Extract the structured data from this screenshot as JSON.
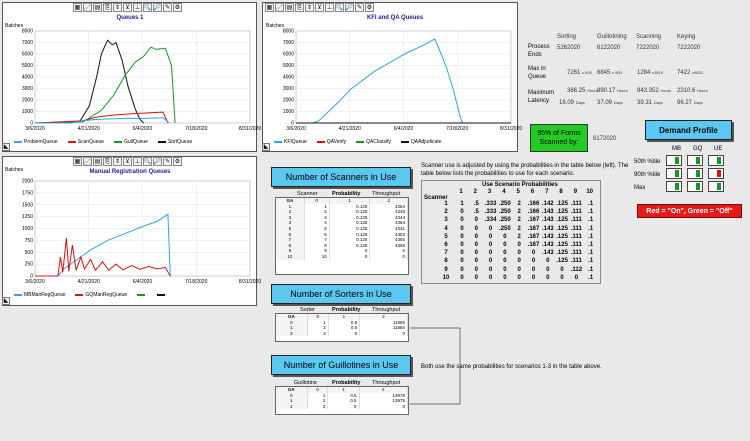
{
  "toolbar_icons": [
    "table-icon",
    "line-chart-icon",
    "bar-chart-icon",
    "export-icon",
    "scale-icon",
    "filter-icon",
    "axis-icon",
    "zoom-in-icon",
    "zoom-out-icon",
    "pen-icon",
    "settings-icon"
  ],
  "toolbar_glyphs": [
    "▦",
    "📈",
    "▤",
    "⎘",
    "⇕",
    "⊻",
    "⊥",
    "🔍",
    "🔎",
    "✎",
    "⚙"
  ],
  "charts": {
    "queues1": {
      "title": "Queues 1",
      "ylabel": "Batches",
      "yticks": [
        "8000",
        "7000",
        "6000",
        "5000",
        "4000",
        "3000",
        "2000",
        "1000",
        "0"
      ],
      "xticks": [
        "3/6/2020",
        "4/21/2020",
        "6/4/2020",
        "7/18/2020",
        "8/31/2020"
      ],
      "legend": [
        {
          "name": "ProblemQueue",
          "color": "#2aa7e6"
        },
        {
          "name": "ScanQueue",
          "color": "#dd1111"
        },
        {
          "name": "GuilQueue",
          "color": "#119922"
        },
        {
          "name": "SortQueue",
          "color": "#111111"
        }
      ]
    },
    "kfi": {
      "title": "KFI and QA Queues",
      "ylabel": "Batches",
      "yticks": [
        "8000",
        "7000",
        "6000",
        "5000",
        "4000",
        "3000",
        "2000",
        "1000",
        "0"
      ],
      "xticks": [
        "3/6/2020",
        "4/21/2020",
        "6/4/2020",
        "7/18/2020",
        "8/31/2020"
      ],
      "legend": [
        {
          "name": "KFIQueue",
          "color": "#2aa7e6"
        },
        {
          "name": "QAVerify",
          "color": "#dd1111"
        },
        {
          "name": "QAClassify",
          "color": "#119922"
        },
        {
          "name": "QAAdjudicate",
          "color": "#111111"
        }
      ]
    },
    "manual": {
      "title": "Manual Registration Queues",
      "ylabel": "Batches",
      "yticks": [
        "2000",
        "1750",
        "1500",
        "1250",
        "1000",
        "750",
        "500",
        "250",
        "0"
      ],
      "xticks": [
        "3/6/2020",
        "4/21/2020",
        "6/4/2020",
        "7/18/2020",
        "8/31/2020"
      ],
      "legend": [
        {
          "name": "MBManRegQueue",
          "color": "#2aa7e6"
        },
        {
          "name": "GQManRegQueue",
          "color": "#dd1111"
        },
        {
          "name": "",
          "color": "#119922"
        },
        {
          "name": "",
          "color": "#111111"
        }
      ]
    }
  },
  "chart_data": [
    {
      "type": "line",
      "title": "Queues 1",
      "ylabel": "Batches",
      "ylim": [
        0,
        8000
      ],
      "xlim": [
        "3/6/2020",
        "8/31/2020"
      ],
      "series": [
        {
          "name": "SortQueue",
          "points": [
            [
              "3/6/2020",
              0
            ],
            [
              "4/12/2020",
              100
            ],
            [
              "4/20/2020",
              1500
            ],
            [
              "4/26/2020",
              4000
            ],
            [
              "4/30/2020",
              6000
            ],
            [
              "5/5/2020",
              7200
            ],
            [
              "5/9/2020",
              6800
            ],
            [
              "5/12/2020",
              7000
            ],
            [
              "5/17/2020",
              5500
            ],
            [
              "5/22/2020",
              3200
            ],
            [
              "5/28/2020",
              1200
            ],
            [
              "6/1/2020",
              300
            ],
            [
              "6/4/2020",
              0
            ]
          ]
        },
        {
          "name": "GuilQueue",
          "points": [
            [
              "3/6/2020",
              0
            ],
            [
              "4/15/2020",
              100
            ],
            [
              "4/30/2020",
              1100
            ],
            [
              "5/10/2020",
              2400
            ],
            [
              "5/20/2020",
              4200
            ],
            [
              "5/28/2020",
              5300
            ],
            [
              "6/4/2020",
              5800
            ],
            [
              "6/10/2020",
              6600
            ],
            [
              "6/14/2020",
              6400
            ],
            [
              "6/22/2020",
              6500
            ],
            [
              "6/27/2020",
              5000
            ],
            [
              "6/30/2020",
              0
            ]
          ]
        },
        {
          "name": "ScanQueue",
          "points": [
            [
              "3/6/2020",
              0
            ],
            [
              "4/15/2020",
              200
            ],
            [
              "4/25/2020",
              500
            ],
            [
              "5/10/2020",
              700
            ],
            [
              "5/25/2020",
              800
            ],
            [
              "6/10/2020",
              900
            ],
            [
              "6/20/2020",
              950
            ],
            [
              "6/24/2020",
              0
            ]
          ]
        },
        {
          "name": "ProblemQueue",
          "points": [
            [
              "3/6/2020",
              0
            ],
            [
              "4/5/2020",
              0
            ],
            [
              "4/15/2020",
              200
            ],
            [
              "4/25/2020",
              300
            ],
            [
              "5/5/2020",
              350
            ],
            [
              "5/20/2020",
              400
            ],
            [
              "6/4/2020",
              400
            ],
            [
              "6/20/2020",
              450
            ],
            [
              "6/25/2020",
              0
            ]
          ]
        }
      ]
    },
    {
      "type": "line",
      "title": "KFI and QA Queues",
      "ylabel": "Batches",
      "ylim": [
        0,
        8000
      ],
      "xlim": [
        "3/6/2020",
        "8/31/2020"
      ],
      "series": [
        {
          "name": "KFIQueue",
          "points": [
            [
              "3/6/2020",
              0
            ],
            [
              "3/20/2020",
              0
            ],
            [
              "3/25/2020",
              200
            ],
            [
              "4/10/2020",
              1800
            ],
            [
              "4/21/2020",
              3000
            ],
            [
              "5/10/2020",
              4500
            ],
            [
              "6/4/2020",
              6000
            ],
            [
              "6/20/2020",
              6800
            ],
            [
              "6/29/2020",
              7300
            ],
            [
              "7/8/2020",
              5000
            ],
            [
              "7/14/2020",
              3000
            ],
            [
              "7/20/2020",
              500
            ],
            [
              "7/22/2020",
              0
            ]
          ]
        },
        {
          "name": "QAVerify",
          "points": [
            [
              "3/6/2020",
              0
            ],
            [
              "8/31/2020",
              0
            ]
          ]
        },
        {
          "name": "QAClassify",
          "points": [
            [
              "3/6/2020",
              0
            ],
            [
              "8/31/2020",
              0
            ]
          ]
        },
        {
          "name": "QAAdjudicate",
          "points": [
            [
              "3/6/2020",
              0
            ],
            [
              "8/31/2020",
              0
            ]
          ]
        }
      ]
    },
    {
      "type": "line",
      "title": "Manual Registration Queues",
      "ylabel": "Batches",
      "ylim": [
        0,
        2000
      ],
      "xlim": [
        "3/6/2020",
        "8/31/2020"
      ],
      "series": [
        {
          "name": "MBManRegQueue",
          "points": [
            [
              "3/6/2020",
              0
            ],
            [
              "3/25/2020",
              0
            ],
            [
              "3/30/2020",
              150
            ],
            [
              "4/10/2020",
              350
            ],
            [
              "4/21/2020",
              550
            ],
            [
              "5/5/2020",
              750
            ],
            [
              "5/20/2020",
              900
            ],
            [
              "6/4/2020",
              1050
            ],
            [
              "6/15/2020",
              1150
            ],
            [
              "6/24/2020",
              1300
            ],
            [
              "6/26/2020",
              0
            ]
          ]
        },
        {
          "name": "GQManRegQueue",
          "points": [
            [
              "3/6/2020",
              0
            ],
            [
              "3/25/2020",
              0
            ],
            [
              "3/27/2020",
              400
            ],
            [
              "3/29/2020",
              80
            ],
            [
              "4/1/2020",
              800
            ],
            [
              "4/3/2020",
              100
            ],
            [
              "4/6/2020",
              650
            ],
            [
              "4/9/2020",
              120
            ],
            [
              "4/13/2020",
              400
            ],
            [
              "4/16/2020",
              150
            ],
            [
              "4/21/2020",
              350
            ],
            [
              "4/25/2020",
              120
            ],
            [
              "5/1/2020",
              300
            ],
            [
              "5/6/2020",
              120
            ],
            [
              "5/12/2020",
              250
            ],
            [
              "5/18/2020",
              130
            ],
            [
              "5/25/2020",
              220
            ],
            [
              "6/1/2020",
              140
            ],
            [
              "6/8/2020",
              200
            ],
            [
              "6/15/2020",
              150
            ],
            [
              "6/22/2020",
              180
            ],
            [
              "6/26/2020",
              0
            ]
          ]
        }
      ]
    }
  ],
  "stats": {
    "columns": [
      "Sorting",
      "Guillotining",
      "Scanning",
      "Keying"
    ],
    "rows": {
      "process_ends": {
        "label": "Process Ends",
        "values": [
          "5262020",
          "6122020",
          "7222020",
          "7222020"
        ]
      },
      "max_queue": {
        "label": "Max in Queue",
        "values": [
          [
            "7261",
            "x 600"
          ],
          [
            "6845",
            "x 500"
          ],
          [
            "1284",
            "x1816"
          ],
          [
            "7422",
            "x9831"
          ]
        ]
      },
      "max_latency": {
        "label": "Maximum Latency",
        "hours": [
          "386.25",
          "890.17",
          "943.352",
          "2310.6"
        ],
        "days": [
          "16.09",
          "37.09",
          "39.31",
          "96.27"
        ],
        "hours_unit": "Hours",
        "days_unit": "Days"
      }
    }
  },
  "forms_scanned": {
    "label": "95% of Forms Scanned by:",
    "value": "6172020",
    "bg": "#22cc22"
  },
  "demand_profile": {
    "title": "Demand Profile",
    "cols": [
      "MB",
      "GQ",
      "UE"
    ],
    "rows": [
      "50th %tile",
      "90th %tile",
      "Max"
    ],
    "note": "Red = \"On\", Green = \"Off\""
  },
  "scanners": {
    "title": "Number of Scanners in Use",
    "headers": [
      "Scanner",
      "Probability",
      "Throughput"
    ],
    "subheads": [
      "0",
      "1",
      "2"
    ],
    "ga": "GA",
    "rows": [
      [
        "1",
        "1",
        "0.125",
        "4354"
      ],
      [
        "2",
        "2",
        "0.125",
        "4349"
      ],
      [
        "3",
        "3",
        "0.125",
        "4344"
      ],
      [
        "4",
        "4",
        "0.125",
        "4354"
      ],
      [
        "5",
        "5",
        "0.125",
        "4341"
      ],
      [
        "6",
        "6",
        "0.125",
        "4353"
      ],
      [
        "7",
        "7",
        "0.125",
        "4355"
      ],
      [
        "8",
        "8",
        "0.125",
        "4358"
      ],
      [
        "9",
        "9",
        "0",
        "0"
      ],
      [
        "10",
        "10",
        "0",
        "0"
      ]
    ]
  },
  "sorters": {
    "title": "Number of Sorters in Use",
    "headers": [
      "Sorter",
      "Probability",
      "Throughput"
    ],
    "subheads": [
      "0",
      "1",
      "2"
    ],
    "ga": "GA",
    "rows": [
      [
        "0",
        "1",
        "0.5",
        "11885"
      ],
      [
        "1",
        "2",
        "0.5",
        "11884"
      ],
      [
        "2",
        "3",
        "0",
        "0"
      ]
    ]
  },
  "guillotines": {
    "title": "Number of Guillotines in Use",
    "headers": [
      "Guillotine",
      "Probability",
      "Throughput"
    ],
    "subheads": [
      "0",
      "1",
      "2"
    ],
    "ga": "GA",
    "rows": [
      [
        "0",
        "1",
        "0.5",
        "13978"
      ],
      [
        "1",
        "2",
        "0.5",
        "13975"
      ],
      [
        "2",
        "3",
        "0",
        "0"
      ]
    ]
  },
  "scanner_note": "Scanner use is adjusted by using the probabilities in the table below (left).  The table below lists the probabilities to use for each scenario.",
  "both_note": "Both use the same probabilities for scenarios 1-3 in the table above.",
  "scenario": {
    "title": "Use Scenario Probabilities",
    "rowhead": "Scanner",
    "cols": [
      "1",
      "2",
      "3",
      "4",
      "5",
      "6",
      "7",
      "8",
      "9",
      "10"
    ],
    "rows": [
      [
        "1",
        "1",
        ".5",
        ".333",
        ".250",
        "2",
        ".166",
        ".142",
        ".125",
        ".111",
        ".1"
      ],
      [
        "2",
        "0",
        ".5",
        ".333",
        ".250",
        "2",
        ".166",
        ".143",
        ".125",
        ".111",
        ".1"
      ],
      [
        "3",
        "0",
        "0",
        ".334",
        ".250",
        "2",
        ".167",
        ".143",
        ".125",
        ".111",
        ".1"
      ],
      [
        "4",
        "0",
        "0",
        "0",
        ".250",
        "2",
        ".167",
        ".143",
        ".125",
        ".111",
        ".1"
      ],
      [
        "5",
        "0",
        "0",
        "0",
        "0",
        "2",
        ".167",
        ".143",
        ".125",
        ".111",
        ".1"
      ],
      [
        "6",
        "0",
        "0",
        "0",
        "0",
        "0",
        ".167",
        ".143",
        ".125",
        ".111",
        ".1"
      ],
      [
        "7",
        "0",
        "0",
        "0",
        "0",
        "0",
        "0",
        ".143",
        ".125",
        ".111",
        ".1"
      ],
      [
        "8",
        "0",
        "0",
        "0",
        "0",
        "0",
        "0",
        "0",
        ".125",
        ".111",
        ".1"
      ],
      [
        "9",
        "0",
        "0",
        "0",
        "0",
        "0",
        "0",
        "0",
        "0",
        ".112",
        ".1"
      ],
      [
        "10",
        "0",
        "0",
        "0",
        "0",
        "0",
        "0",
        "0",
        "0",
        "0",
        ".1"
      ]
    ]
  }
}
